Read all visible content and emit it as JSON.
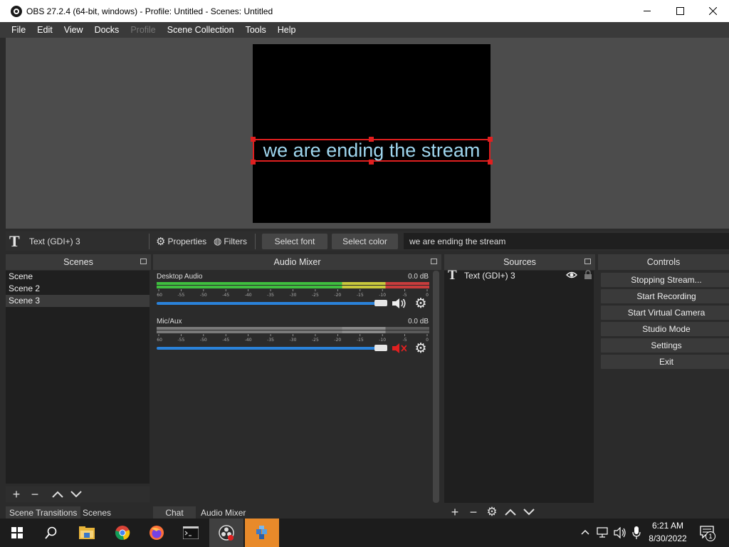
{
  "window": {
    "title": "OBS 27.2.4 (64-bit, windows) - Profile: Untitled - Scenes: Untitled",
    "minimize": "—",
    "maximize": "☐",
    "close": "✕"
  },
  "menu": [
    "File",
    "Edit",
    "View",
    "Docks",
    "Profile",
    "Scene Collection",
    "Tools",
    "Help"
  ],
  "preview": {
    "text": "we are ending the stream",
    "text_color": "#9fd6ee",
    "selection_color": "#e01f1f"
  },
  "context_bar": {
    "source_name": "Text (GDI+) 3",
    "properties": "Properties",
    "filters": "Filters",
    "select_font": "Select font",
    "select_color": "Select color",
    "text_value": "we are ending the stream"
  },
  "scenes": {
    "header": "Scenes",
    "items": [
      "Scene",
      "Scene 2",
      "Scene 3"
    ],
    "selected": "Scene 3"
  },
  "audio_mixer": {
    "header": "Audio Mixer",
    "channels": [
      {
        "name": "Desktop Audio",
        "db": "0.0 dB",
        "muted": false
      },
      {
        "name": "Mic/Aux",
        "db": "0.0 dB",
        "muted": true
      }
    ],
    "ticks": [
      "-60",
      "-55",
      "-50",
      "-45",
      "-40",
      "-35",
      "-30",
      "-25",
      "-20",
      "-15",
      "-10",
      "-5",
      "0"
    ]
  },
  "sources": {
    "header": "Sources",
    "items": [
      {
        "name": "Text (GDI+) 3",
        "visible": true,
        "locked": false
      }
    ]
  },
  "controls": {
    "header": "Controls",
    "buttons": [
      "Stopping Stream...",
      "Start Recording",
      "Start Virtual Camera",
      "Studio Mode",
      "Settings",
      "Exit"
    ]
  },
  "bottom_tabs": {
    "left": [
      "Scene Transitions",
      "Scenes"
    ],
    "middle": [
      "Chat",
      "Audio Mixer"
    ]
  },
  "taskbar": {
    "time": "6:21 AM",
    "date": "8/30/2022",
    "notification_count": "1",
    "apps": [
      "start",
      "search",
      "file-explorer",
      "chrome",
      "firefox",
      "terminal",
      "obs",
      "app"
    ]
  }
}
